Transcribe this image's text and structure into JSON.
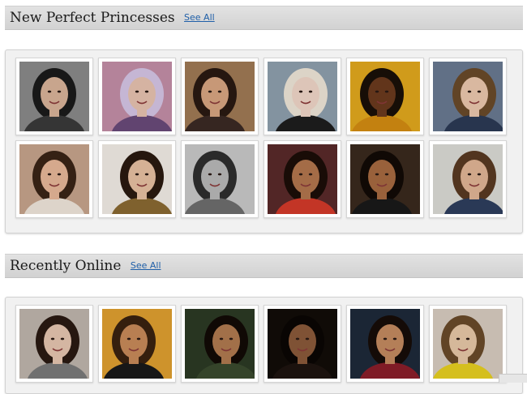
{
  "sections": [
    {
      "title": "New Perfect Princesses",
      "see_all": "See All",
      "photos": [
        {
          "bg": "#8a8a8a",
          "skin": "#d9b49a",
          "hair": "#1b1b1b",
          "top": "#3a3a3a"
        },
        {
          "bg": "#c48fa8",
          "skin": "#e8c3b0",
          "hair": "#d6c6e6",
          "top": "#6a4a7a"
        },
        {
          "bg": "#a07a55",
          "skin": "#d8a582",
          "hair": "#2a1a12",
          "top": "#3b2a24"
        },
        {
          "bg": "#8fa0ae",
          "skin": "#f0d6c8",
          "hair": "#efe6d8",
          "top": "#1e1e1e"
        },
        {
          "bg": "#e2a91e",
          "skin": "#6b3a1e",
          "hair": "#1a1008",
          "top": "#d48d12"
        },
        {
          "bg": "#6a7a92",
          "skin": "#ecc8ae",
          "hair": "#6a4a2a",
          "top": "#2c3a55"
        },
        {
          "bg": "#c7a48c",
          "skin": "#e8b89a",
          "hair": "#3a2416",
          "top": "#f0e6dc"
        },
        {
          "bg": "#f2ede6",
          "skin": "#e8c0a2",
          "hair": "#2a1a10",
          "top": "#8a6a32"
        },
        {
          "bg": "#c9c9c9",
          "skin": "#b9b9b9",
          "hair": "#2e2e2e",
          "top": "#6e6e6e"
        },
        {
          "bg": "#5a2a2a",
          "skin": "#b2764e",
          "hair": "#1c0e08",
          "top": "#d43a2a"
        },
        {
          "bg": "#3a2a1e",
          "skin": "#a66a40",
          "hair": "#120a06",
          "top": "#1a1a1a"
        },
        {
          "bg": "#dcdcd6",
          "skin": "#e2b696",
          "hair": "#5a3a22",
          "top": "#2e3e5e"
        }
      ]
    },
    {
      "title": "Recently Online",
      "see_all": "See All",
      "photos": [
        {
          "bg": "#bfb6ad",
          "skin": "#e6c6b0",
          "hair": "#2a1a12",
          "top": "#7a7a7a"
        },
        {
          "bg": "#e0a030",
          "skin": "#c88a5a",
          "hair": "#3a2210",
          "top": "#1a1a1a"
        },
        {
          "bg": "#2c3a24",
          "skin": "#b07a50",
          "hair": "#120a06",
          "top": "#3a4a2e"
        },
        {
          "bg": "#120c08",
          "skin": "#8a5a3a",
          "hair": "#0a0604",
          "top": "#1e1410"
        },
        {
          "bg": "#1e2a3a",
          "skin": "#c48a60",
          "hair": "#160c08",
          "top": "#8a1e2a"
        },
        {
          "bg": "#d8ccc0",
          "skin": "#e8c8a8",
          "hair": "#6a4a2a",
          "top": "#e8d020"
        }
      ]
    }
  ]
}
